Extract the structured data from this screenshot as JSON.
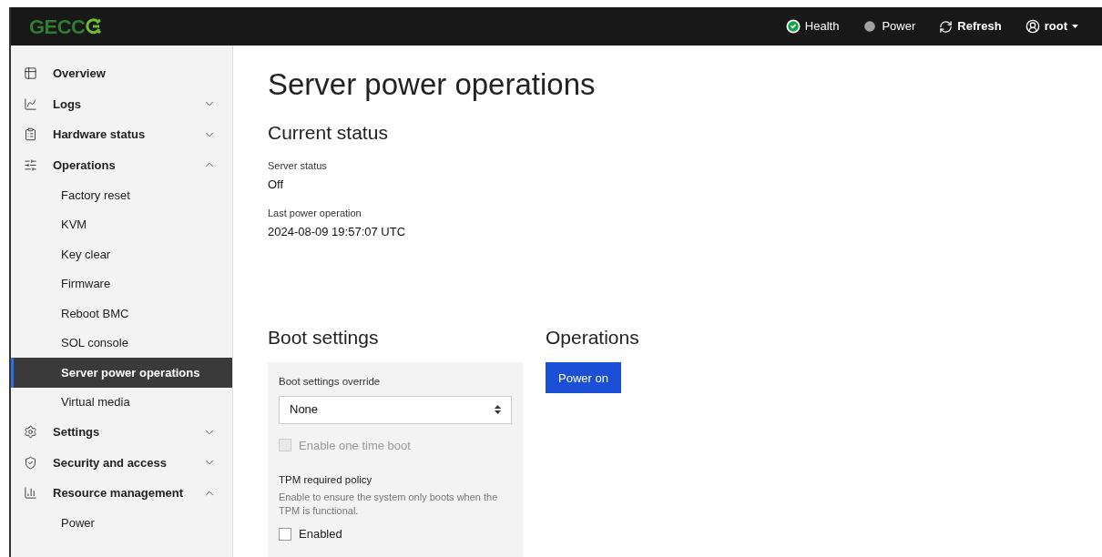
{
  "header": {
    "brand": "GECC",
    "actions": [
      {
        "kind": "health",
        "label": "Health"
      },
      {
        "kind": "power",
        "label": "Power"
      },
      {
        "kind": "refresh",
        "label": "Refresh"
      },
      {
        "kind": "user",
        "label": "root"
      }
    ]
  },
  "sidebar": {
    "items": [
      {
        "kind": "overview",
        "label": "Overview"
      },
      {
        "kind": "logs",
        "label": "Logs",
        "expanded": false
      },
      {
        "kind": "hardware",
        "label": "Hardware status",
        "expanded": false
      },
      {
        "kind": "operations",
        "label": "Operations",
        "expanded": true,
        "children": [
          {
            "label": "Factory reset",
            "selected": false
          },
          {
            "label": "KVM",
            "selected": false
          },
          {
            "label": "Key clear",
            "selected": false
          },
          {
            "label": "Firmware",
            "selected": false
          },
          {
            "label": "Reboot BMC",
            "selected": false
          },
          {
            "label": "SOL console",
            "selected": false
          },
          {
            "label": "Server power operations",
            "selected": true
          },
          {
            "label": "Virtual media",
            "selected": false
          }
        ]
      },
      {
        "kind": "settings",
        "label": "Settings",
        "expanded": false
      },
      {
        "kind": "security",
        "label": "Security and access",
        "expanded": false
      },
      {
        "kind": "resource",
        "label": "Resource management",
        "expanded": true,
        "children": [
          {
            "label": "Power",
            "selected": false
          }
        ]
      }
    ]
  },
  "page": {
    "title": "Server power operations",
    "current_status": {
      "heading": "Current status",
      "fields": [
        {
          "label": "Server status",
          "value": "Off"
        },
        {
          "label": "Last power operation",
          "value": "2024-08-09 19:57:07 UTC"
        }
      ]
    },
    "boot_settings": {
      "heading": "Boot settings",
      "override_label": "Boot settings override",
      "override_value": "None",
      "one_time_boot": {
        "label": "Enable one time boot",
        "checked": false,
        "disabled": true
      },
      "tpm": {
        "heading": "TPM required policy",
        "description": "Enable to ensure the system only boots when the TPM is functional.",
        "checkbox": {
          "label": "Enabled",
          "checked": false,
          "disabled": false
        }
      }
    },
    "operations": {
      "heading": "Operations",
      "buttons": [
        "Power on"
      ]
    }
  }
}
